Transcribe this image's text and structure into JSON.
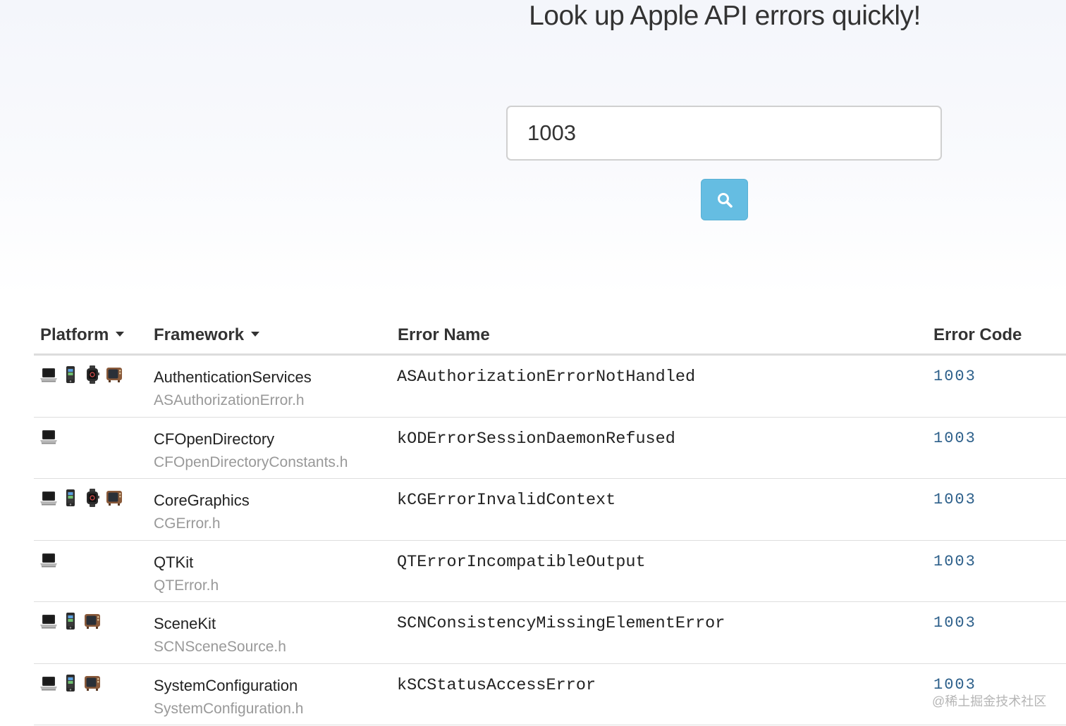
{
  "hero": {
    "title": "Look up Apple API errors quickly!"
  },
  "search": {
    "value": "1003",
    "button_icon": "search-icon",
    "button_color": "#65bde2"
  },
  "table": {
    "headers": {
      "platform": "Platform",
      "framework": "Framework",
      "error_name": "Error Name",
      "error_code": "Error Code"
    },
    "rows": [
      {
        "platforms": [
          "macos",
          "ios",
          "watchos",
          "tvos"
        ],
        "framework": "AuthenticationServices",
        "header_file": "ASAuthorizationError.h",
        "error_name": "ASAuthorizationErrorNotHandled",
        "error_code": "1003"
      },
      {
        "platforms": [
          "macos"
        ],
        "framework": "CFOpenDirectory",
        "header_file": "CFOpenDirectoryConstants.h",
        "error_name": "kODErrorSessionDaemonRefused",
        "error_code": "1003"
      },
      {
        "platforms": [
          "macos",
          "ios",
          "watchos",
          "tvos"
        ],
        "framework": "CoreGraphics",
        "header_file": "CGError.h",
        "error_name": "kCGErrorInvalidContext",
        "error_code": "1003"
      },
      {
        "platforms": [
          "macos"
        ],
        "framework": "QTKit",
        "header_file": "QTError.h",
        "error_name": "QTErrorIncompatibleOutput",
        "error_code": "1003"
      },
      {
        "platforms": [
          "macos",
          "ios",
          "tvos"
        ],
        "framework": "SceneKit",
        "header_file": "SCNSceneSource.h",
        "error_name": "SCNConsistencyMissingElementError",
        "error_code": "1003"
      },
      {
        "platforms": [
          "macos",
          "ios",
          "tvos"
        ],
        "framework": "SystemConfiguration",
        "header_file": "SystemConfiguration.h",
        "error_name": "kSCStatusAccessError",
        "error_code": "1003"
      }
    ]
  },
  "watermark": "@稀土掘金技术社区",
  "colors": {
    "link": "#2c5f8a",
    "muted_text": "#999999",
    "divider": "#dedede"
  }
}
